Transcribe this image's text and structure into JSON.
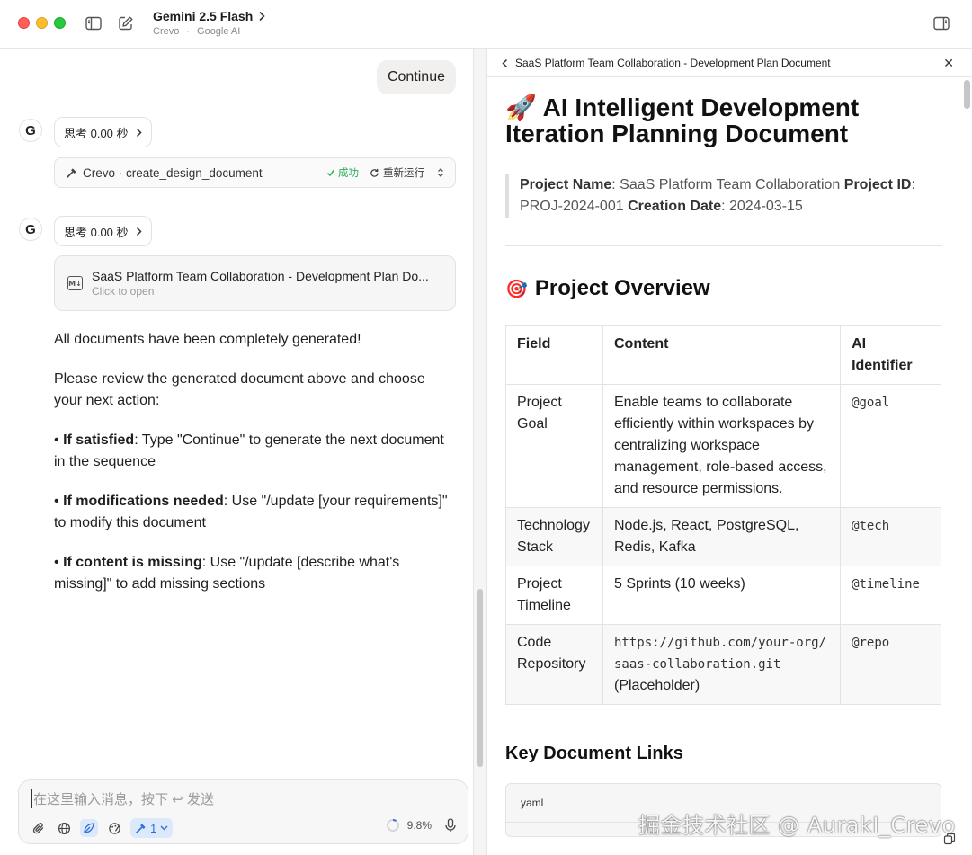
{
  "titlebar": {
    "model_name": "Gemini 2.5 Flash",
    "provider_app": "Crevo",
    "provider_sep": "·",
    "provider": "Google AI"
  },
  "chat": {
    "user_message": "Continue",
    "turns": [
      {
        "avatar": "G",
        "thinking_label": "思考 0.00 秒",
        "tool": {
          "name": "Crevo · create_design_document",
          "status": "成功",
          "rerun_label": "重新运行"
        }
      },
      {
        "avatar": "G",
        "thinking_label": "思考 0.00 秒",
        "document": {
          "title": "SaaS Platform Team Collaboration - Development Plan Do...",
          "subtitle": "Click to open",
          "icon": "markdown-icon"
        }
      }
    ],
    "reply": {
      "p1": "All documents have been completely generated!",
      "p2": "Please review the generated document above and choose your next action:",
      "b1_label": "If satisfied",
      "b1_text": ": Type \"Continue\" to generate the next document in the sequence",
      "b2_label": "If modifications needed",
      "b2_text": ": Use \"/update [your requirements]\" to modify this document",
      "b3_label": "If content is missing",
      "b3_text": ": Use \"/update [describe what's missing]\" to add missing sections",
      "bullet": "•"
    },
    "composer": {
      "placeholder": "在这里输入消息，按下 ↩ 发送",
      "tool_count": "1",
      "context_usage": "9.8%"
    }
  },
  "doc_panel": {
    "header_title": "SaaS Platform Team Collaboration - Development Plan Document",
    "h1_emoji": "🚀",
    "h1": "AI Intelligent Development Iteration Planning Document",
    "meta": {
      "name_label": "Project Name",
      "name_value": ": SaaS Platform Team Collaboration ",
      "id_label": "Project ID",
      "id_value": ": PROJ-2024-001 ",
      "date_label": "Creation Date",
      "date_value": ": 2024-03-15"
    },
    "overview_emoji": "🎯",
    "overview_heading": "Project Overview",
    "table": {
      "headers": [
        "Field",
        "Content",
        "AI Identifier"
      ],
      "rows": [
        [
          "Project Goal",
          "Enable teams to collaborate efficiently within workspaces by centralizing workspace management, role-based access, and resource permissions.",
          "@goal"
        ],
        [
          "Technology Stack",
          "Node.js, React, PostgreSQL, Redis, Kafka",
          "@tech"
        ],
        [
          "Project Timeline",
          "5 Sprints (10 weeks)",
          "@timeline"
        ],
        [
          "Code Repository",
          "https://github.com/your-org/saas-collaboration.git",
          "@repo"
        ]
      ],
      "repo_suffix": "(Placeholder)"
    },
    "links_heading": "Key Document Links",
    "code_lang": "yaml"
  },
  "watermark": "掘金技术社区 @ AurakI_Crevo",
  "colors": {
    "success": "#2fae5c",
    "accent": "#2f6fd6",
    "traffic_red": "#ff5f57",
    "traffic_yellow": "#febc2e",
    "traffic_green": "#28c840"
  }
}
